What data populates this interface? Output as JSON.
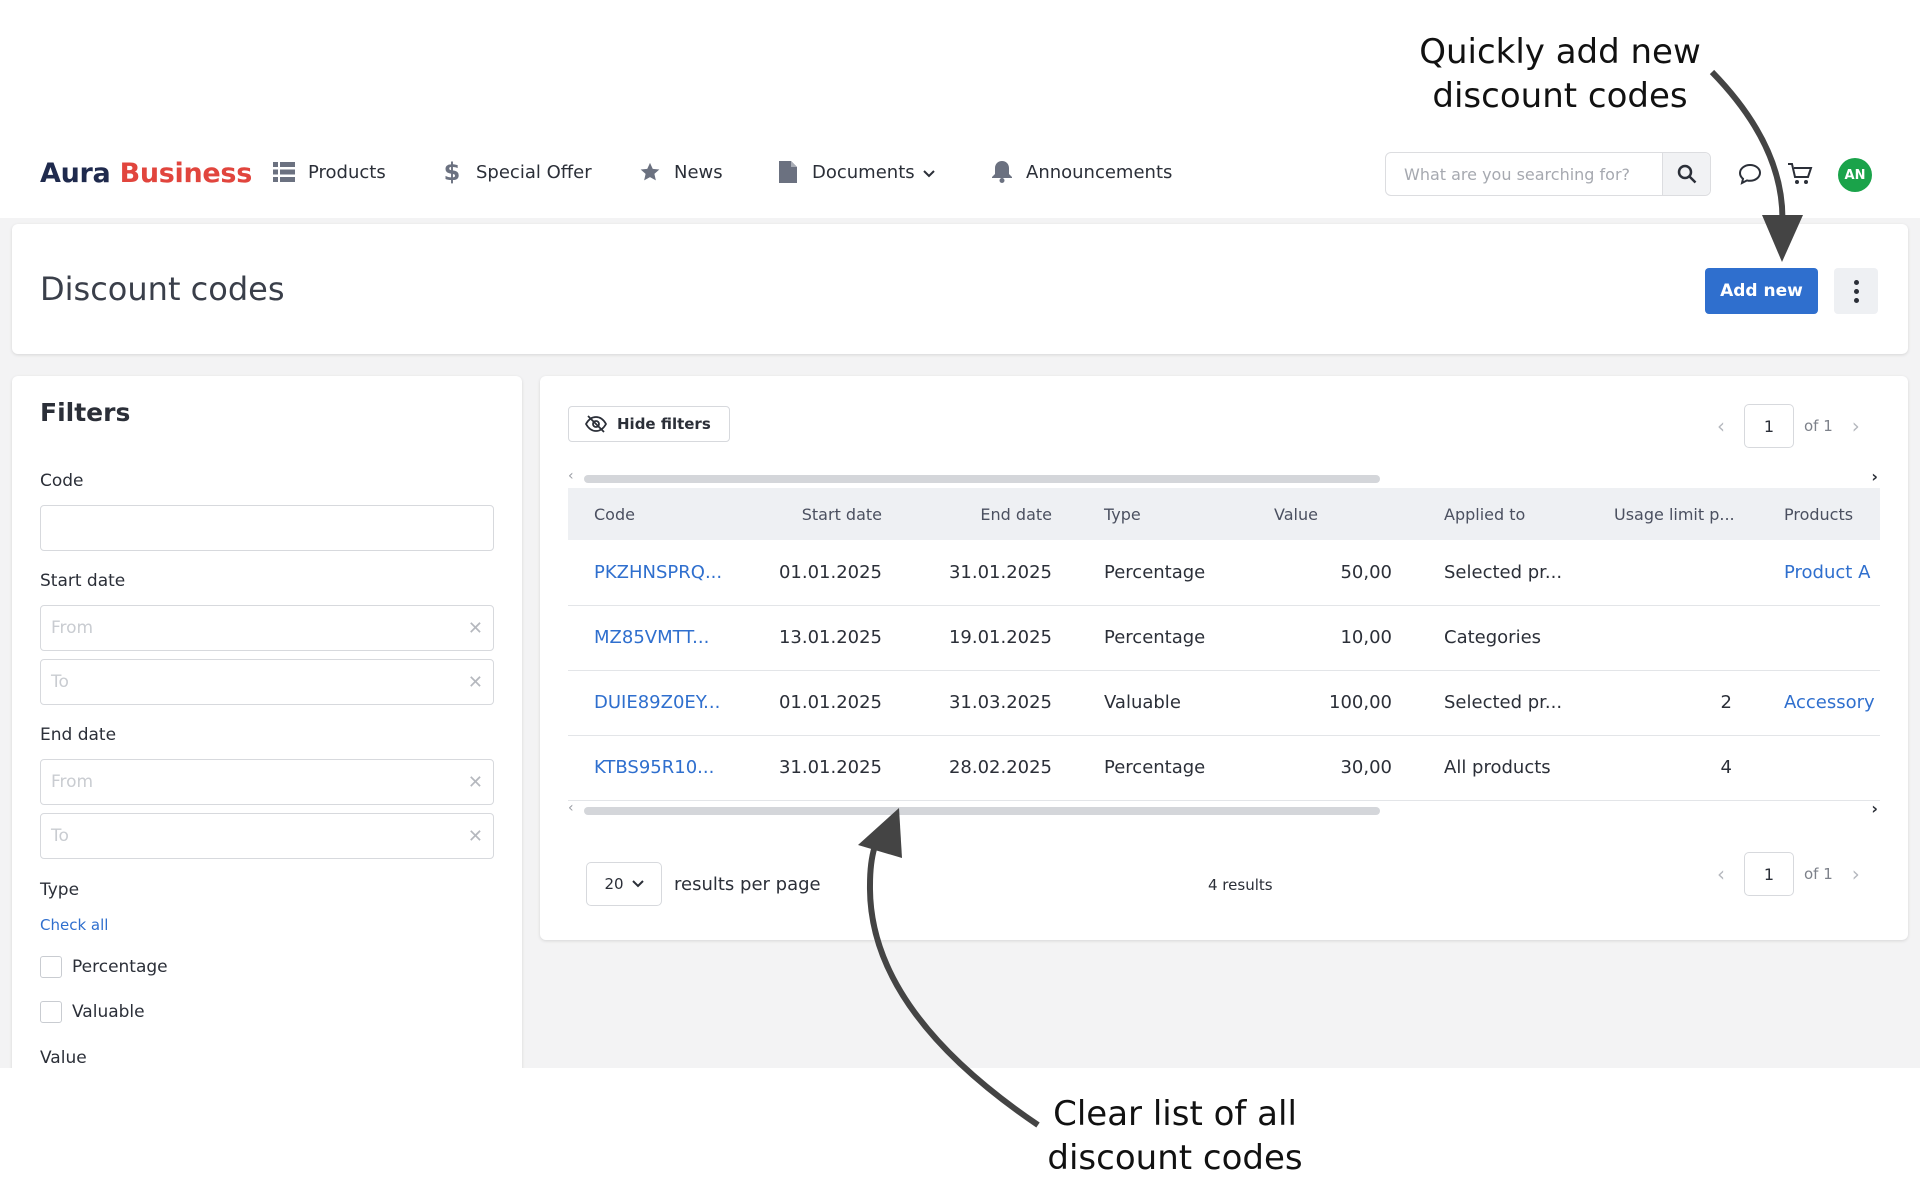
{
  "annotations": {
    "top_line1": "Quickly add new",
    "top_line2": "discount codes",
    "bottom_line1": "Clear list of all",
    "bottom_line2": "discount codes"
  },
  "brand": {
    "part1": "Aura",
    "part2": "Business",
    "color1": "#1f2a4d",
    "color2": "#e1453d"
  },
  "nav": [
    {
      "label": "Products",
      "icon": "list-icon"
    },
    {
      "label": "Special Offer",
      "icon": "dollar-icon"
    },
    {
      "label": "News",
      "icon": "star-icon"
    },
    {
      "label": "Documents",
      "icon": "document-icon",
      "dropdown": true
    },
    {
      "label": "Announcements",
      "icon": "bell-icon"
    }
  ],
  "search": {
    "placeholder": "What are you searching for?"
  },
  "user": {
    "initials": "AN",
    "color": "#1aa34a"
  },
  "page": {
    "title": "Discount codes",
    "add_label": "Add new",
    "accent": "#2f6fce"
  },
  "filters": {
    "title": "Filters",
    "code_label": "Code",
    "start_label": "Start date",
    "end_label": "End date",
    "from_placeholder": "From",
    "to_placeholder": "To",
    "type_label": "Type",
    "check_all": "Check all",
    "type_options": [
      "Percentage",
      "Valuable"
    ],
    "value_label": "Value"
  },
  "toolbar": {
    "hide_filters": "Hide filters"
  },
  "pagination": {
    "page": "1",
    "of": "of 1",
    "per_page": "20",
    "per_page_label": "results per page",
    "results": "4 results"
  },
  "table": {
    "columns": [
      "Code",
      "Start date",
      "End date",
      "Type",
      "Value",
      "Applied to",
      "Usage limit p...",
      "Products"
    ],
    "rows": [
      {
        "code": "PKZHNSPRQ...",
        "start": "01.01.2025",
        "end": "31.01.2025",
        "type": "Percentage",
        "value": "50,00",
        "applied": "Selected pr...",
        "limit": "",
        "products": "Product A"
      },
      {
        "code": "MZ85VMTT...",
        "start": "13.01.2025",
        "end": "19.01.2025",
        "type": "Percentage",
        "value": "10,00",
        "applied": "Categories",
        "limit": "",
        "products": ""
      },
      {
        "code": "DUIE89Z0EY...",
        "start": "01.01.2025",
        "end": "31.03.2025",
        "type": "Valuable",
        "value": "100,00",
        "applied": "Selected pr...",
        "limit": "2",
        "products": "Accessory"
      },
      {
        "code": "KTBS95R10...",
        "start": "31.01.2025",
        "end": "28.02.2025",
        "type": "Percentage",
        "value": "30,00",
        "applied": "All products",
        "limit": "4",
        "products": ""
      }
    ]
  }
}
